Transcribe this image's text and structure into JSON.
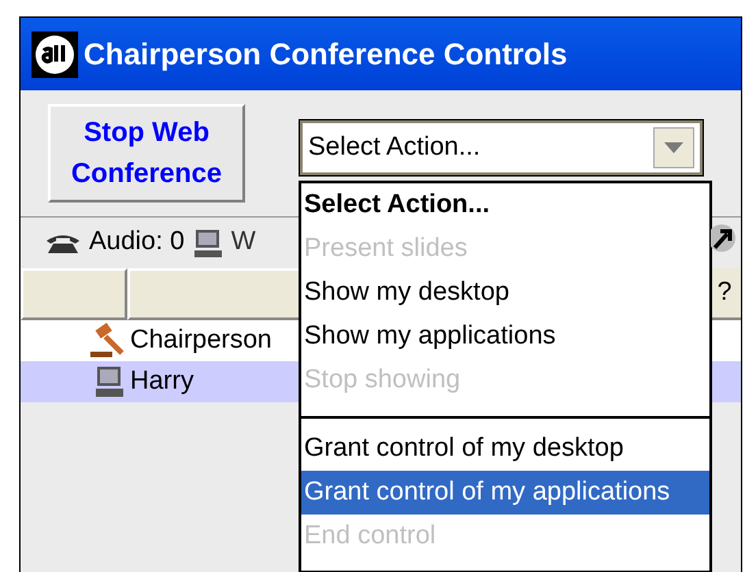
{
  "window": {
    "title": "Chairperson Conference Controls"
  },
  "stop_button": {
    "label": "Stop Web Conference"
  },
  "action_select": {
    "value": "Select Action...",
    "expanded": true
  },
  "toolbar": {
    "audio": "Audio: 0",
    "web": "W"
  },
  "table": {
    "header_mark": "?",
    "rows": [
      {
        "kind": "gavel",
        "name": "Chairperson",
        "selected": false
      },
      {
        "kind": "computer",
        "name": "Harry",
        "selected": true
      }
    ]
  },
  "dropdown": {
    "items": [
      {
        "kind": "heading",
        "label": "Select Action...",
        "disabled": false,
        "selected": false
      },
      {
        "kind": "option",
        "label": "Present slides",
        "disabled": true,
        "selected": false
      },
      {
        "kind": "option",
        "label": "Show my desktop",
        "disabled": false,
        "selected": false
      },
      {
        "kind": "option",
        "label": "Show my applications",
        "disabled": false,
        "selected": false
      },
      {
        "kind": "option",
        "label": "Stop showing",
        "disabled": true,
        "selected": false
      },
      {
        "kind": "separator"
      },
      {
        "kind": "option",
        "label": "Grant control of my desktop",
        "disabled": false,
        "selected": false
      },
      {
        "kind": "option",
        "label": "Grant control of my applications",
        "disabled": false,
        "selected": true
      },
      {
        "kind": "option",
        "label": "End control",
        "disabled": true,
        "selected": false
      }
    ]
  }
}
